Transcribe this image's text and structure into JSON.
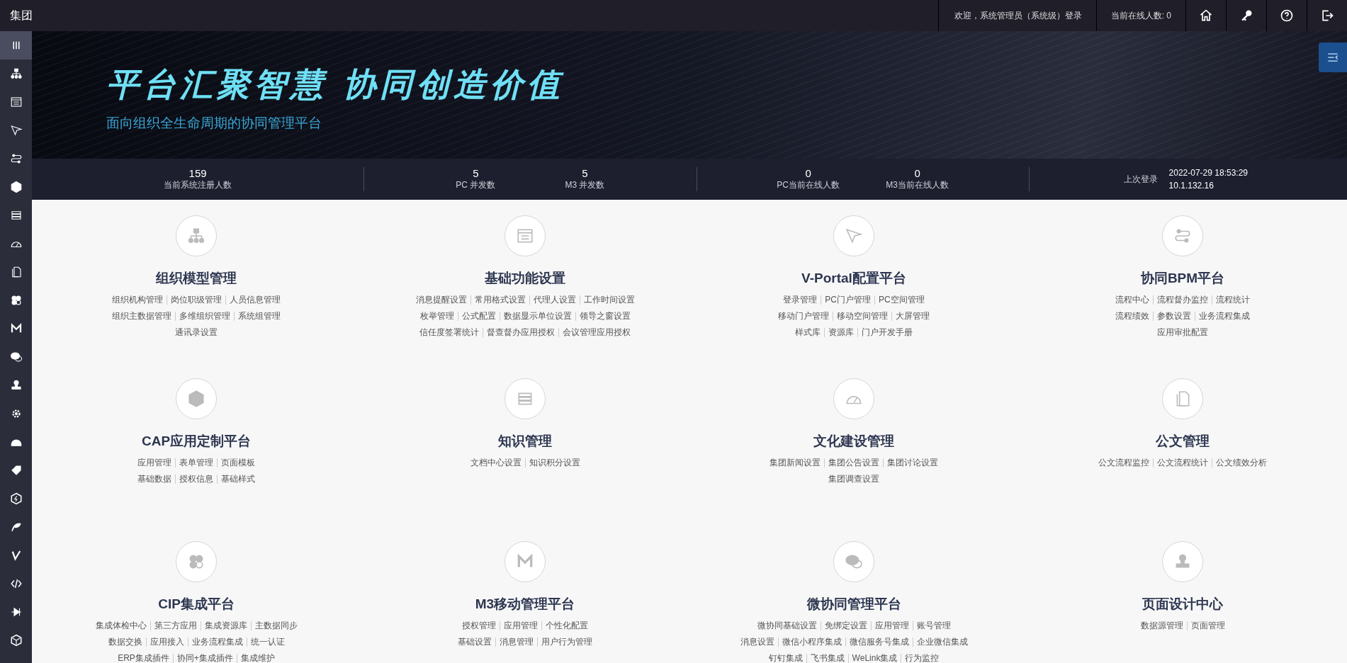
{
  "topbar": {
    "brand": "集团",
    "welcome": "欢迎，系统管理员（系统级）登录",
    "online": "当前在线人数: 0"
  },
  "sidebar": {
    "items": [
      {
        "selected": true
      },
      {
        "selected": false
      },
      {
        "selected": false
      },
      {
        "selected": false
      },
      {
        "selected": false
      },
      {
        "selected": false
      },
      {
        "selected": false
      },
      {
        "selected": false
      },
      {
        "selected": false
      },
      {
        "selected": false
      },
      {
        "selected": false
      },
      {
        "selected": false
      },
      {
        "selected": false
      },
      {
        "selected": false
      },
      {
        "selected": false
      },
      {
        "selected": false
      },
      {
        "selected": false
      },
      {
        "selected": false
      },
      {
        "selected": false
      },
      {
        "selected": false
      },
      {
        "selected": false
      },
      {
        "selected": false
      }
    ]
  },
  "banner": {
    "slogan": "平台汇聚智慧 协同创造价值",
    "subtitle": "面向组织全生命周期的协同管理平台"
  },
  "stats": {
    "groups": [
      {
        "items": [
          {
            "value": "159",
            "label": "当前系统注册人数"
          }
        ]
      },
      {
        "items": [
          {
            "value": "5",
            "label": "PC 并发数"
          },
          {
            "value": "5",
            "label": "M3 并发数"
          }
        ]
      },
      {
        "items": [
          {
            "value": "0",
            "label": "PC当前在线人数"
          },
          {
            "value": "0",
            "label": "M3当前在线人数"
          }
        ]
      }
    ],
    "last_login": {
      "label": "上次登录",
      "time": "2022-07-29 18:53:29",
      "ip": "10.1.132.16"
    }
  },
  "modules": [
    {
      "title": "组织模型管理",
      "lines": [
        [
          "组织机构管理",
          "岗位职级管理",
          "人员信息管理"
        ],
        [
          "组织主数据管理",
          "多维组织管理",
          "系统组管理"
        ],
        [
          "通讯录设置"
        ]
      ]
    },
    {
      "title": "基础功能设置",
      "lines": [
        [
          "消息提醒设置",
          "常用格式设置",
          "代理人设置",
          "工作时间设置"
        ],
        [
          "枚举管理",
          "公式配置",
          "数据显示单位设置",
          "领导之窗设置"
        ],
        [
          "信任度签署统计",
          "督查督办应用授权",
          "会议管理应用授权"
        ]
      ]
    },
    {
      "title": "V-Portal配置平台",
      "lines": [
        [
          "登录管理",
          "PC门户管理",
          "PC空间管理"
        ],
        [
          "移动门户管理",
          "移动空间管理",
          "大屏管理"
        ],
        [
          "样式库",
          "资源库",
          "门户开发手册"
        ]
      ]
    },
    {
      "title": "协同BPM平台",
      "lines": [
        [
          "流程中心",
          "流程督办监控",
          "流程统计"
        ],
        [
          "流程绩效",
          "参数设置",
          "业务流程集成"
        ],
        [
          "应用审批配置"
        ]
      ]
    },
    {
      "title": "CAP应用定制平台",
      "lines": [
        [
          "应用管理",
          "表单管理",
          "页面模板"
        ],
        [
          "基础数据",
          "授权信息",
          "基础样式"
        ]
      ]
    },
    {
      "title": "知识管理",
      "lines": [
        [
          "文档中心设置",
          "知识积分设置"
        ]
      ]
    },
    {
      "title": "文化建设管理",
      "lines": [
        [
          "集团新闻设置",
          "集团公告设置",
          "集团讨论设置"
        ],
        [
          "集团调查设置"
        ]
      ]
    },
    {
      "title": "公文管理",
      "lines": [
        [
          "公文流程监控",
          "公文流程统计",
          "公文绩效分析"
        ]
      ]
    },
    {
      "title": "CIP集成平台",
      "lines": [
        [
          "集成体检中心",
          "第三方应用",
          "集成资源库",
          "主数据同步"
        ],
        [
          "数据交换",
          "应用接入",
          "业务流程集成",
          "统一认证"
        ],
        [
          "ERP集成插件",
          "协同+集成插件",
          "集成维护"
        ]
      ]
    },
    {
      "title": "M3移动管理平台",
      "lines": [
        [
          "授权管理",
          "应用管理",
          "个性化配置"
        ],
        [
          "基础设置",
          "消息管理",
          "用户行为管理"
        ]
      ]
    },
    {
      "title": "微协同管理平台",
      "lines": [
        [
          "微协同基础设置",
          "免绑定设置",
          "应用管理",
          "账号管理"
        ],
        [
          "消息设置",
          "微信小程序集成",
          "微信服务号集成",
          "企业微信集成"
        ],
        [
          "钉钉集成",
          "飞书集成",
          "WeLink集成",
          "行为监控"
        ]
      ]
    },
    {
      "title": "页面设计中心",
      "lines": [
        [
          "数据源管理",
          "页面管理"
        ]
      ]
    }
  ]
}
